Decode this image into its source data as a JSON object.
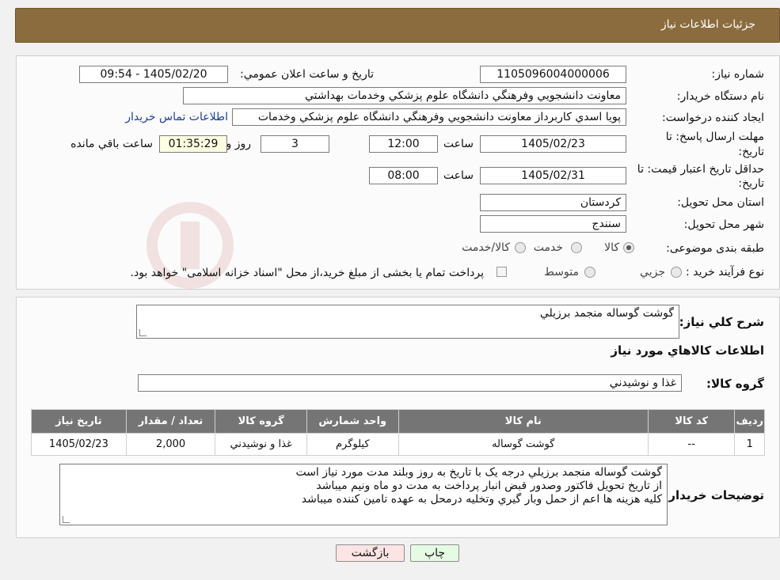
{
  "header": {
    "title": "جزئیات اطلاعات نیاز"
  },
  "form": {
    "need_number_label": "شماره نیاز:",
    "need_number": "1105096004000006",
    "announce_label": "تاریخ و ساعت اعلان عمومي:",
    "announce_value": "1405/02/20 - 09:54",
    "buyer_org_label": "نام دستگاه خریدار:",
    "buyer_org": "معاونت دانشجويي وفرهنگي دانشگاه علوم پزشكي وخدمات بهداشتي",
    "creator_label": "ایجاد کننده درخواست:",
    "creator": "پويا اسدي كاربرداز معاونت دانشجويي وفرهنگي دانشگاه علوم پزشكي وخدمات",
    "contact_link": "اطلاعات تماس خریدار",
    "deadline_label_1": "مهلت ارسال پاسخ: تا",
    "deadline_label_2": "تاریخ:",
    "deadline_date": "1405/02/23",
    "time_word": "ساعت",
    "deadline_time": "12:00",
    "days_value": "3",
    "days_word": "روز و",
    "remaining_time": "01:35:29",
    "remaining_word": "ساعت باقي مانده",
    "validity_label_1": "حداقل تاریخ اعتبار قیمت: تا",
    "validity_label_2": "تاریخ:",
    "validity_date": "1405/02/31",
    "validity_time": "08:00",
    "province_label": "استان محل تحویل:",
    "province": "كردستان",
    "city_label": "شهر محل تحویل:",
    "city": "سنندج",
    "category_label": "طبقه بندی موضوعی:",
    "category_options": [
      "كالا",
      "خدمت",
      "كالا/خدمت"
    ],
    "process_label": "نوع فرآیند خرید :",
    "process_options": [
      "جزيي",
      "متوسط"
    ],
    "process_note": "پرداخت تمام یا بخشی از مبلغ خرید،از محل \"اسناد خزانه اسلامی\" خواهد بود."
  },
  "details": {
    "summary_label": "شرح كلي نياز:",
    "summary": "گوشت گوساله منجمد برزيلي",
    "goods_info_title": "اطلاعات كالاهاي مورد نياز",
    "goods_group_label": "گروه كالا:",
    "goods_group": "غذا و نوشيدني",
    "table": {
      "headers": [
        "رديف",
        "كد كالا",
        "نام كالا",
        "واحد شمارش",
        "گروه كالا",
        "تعداد / مقدار",
        "تاريخ نياز"
      ],
      "rows": [
        [
          "1",
          "--",
          "گوشت گوساله",
          "كيلوگرم",
          "غذا و نوشيدني",
          "2,000",
          "1405/02/23"
        ]
      ]
    },
    "buyer_notes_label": "توضیحات خریدار:",
    "buyer_notes": [
      "گوشت گوساله منجمد برزيلي درجه يک  با تاريخ به روز وبلند مدت مورد نياز است",
      "از تاريخ تحويل فاکتور وصدور قبض انبار پرداخت به مدت دو ماه ونيم ميباشد",
      "کليه هزينه ها اعم از حمل وبار گيري وتخليه درمحل به عهده تامين کننده ميباشد"
    ]
  },
  "buttons": {
    "print": "چاپ",
    "back": "بازگشت"
  },
  "colors": {
    "header_bg": "#8b6c3e",
    "table_header_bg": "#757575",
    "link": "#1c3f95",
    "back_button_bg": "#fde4e4",
    "print_button_bg": "#e6fbe3"
  }
}
